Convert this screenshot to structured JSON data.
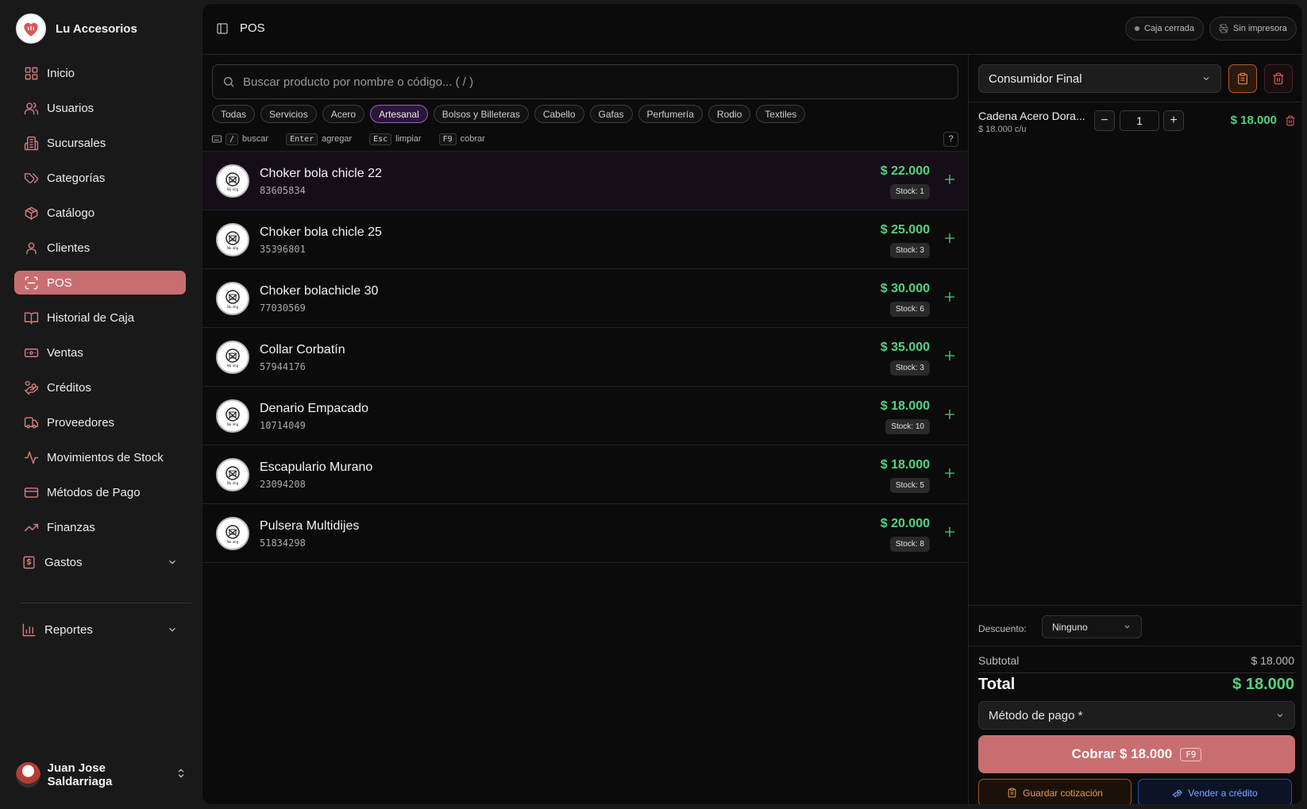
{
  "brand": {
    "name": "Lu Accesorios"
  },
  "nav": {
    "items": [
      {
        "label": "Inicio",
        "icon": "grid-icon"
      },
      {
        "label": "Usuarios",
        "icon": "users-icon"
      },
      {
        "label": "Sucursales",
        "icon": "building-icon"
      },
      {
        "label": "Categorías",
        "icon": "tags-icon"
      },
      {
        "label": "Catálogo",
        "icon": "package-icon"
      },
      {
        "label": "Clientes",
        "icon": "user-icon"
      },
      {
        "label": "POS",
        "icon": "scan-icon",
        "active": true
      },
      {
        "label": "Historial de Caja",
        "icon": "book-icon"
      },
      {
        "label": "Ventas",
        "icon": "banknote-icon"
      },
      {
        "label": "Créditos",
        "icon": "hand-coins-icon"
      },
      {
        "label": "Proveedores",
        "icon": "truck-icon"
      },
      {
        "label": "Movimientos de Stock",
        "icon": "activity-icon"
      },
      {
        "label": "Métodos de Pago",
        "icon": "credit-card-icon"
      },
      {
        "label": "Finanzas",
        "icon": "trending-up-icon"
      },
      {
        "label": "Gastos",
        "icon": "receipt-icon"
      }
    ],
    "reports": "Reportes"
  },
  "user": {
    "name": "Juan Jose Saldarriaga"
  },
  "topbar": {
    "title": "POS",
    "cash_status": "Caja cerrada",
    "printer_status": "Sin impresora"
  },
  "search": {
    "placeholder": "Buscar producto por nombre o código... ( / )"
  },
  "categories": [
    "Todas",
    "Servicios",
    "Acero",
    "Artesanal",
    "Bolsos y Billeteras",
    "Cabello",
    "Gafas",
    "Perfumería",
    "Rodio",
    "Textiles"
  ],
  "active_category": "Artesanal",
  "shortcuts": {
    "k1": "/",
    "t1": "buscar",
    "k2": "Enter",
    "t2": "agregar",
    "k3": "Esc",
    "t3": "limpiar",
    "k4": "F9",
    "t4": "cobrar",
    "help": "?"
  },
  "products": [
    {
      "name": "Choker bola chicle 22",
      "code": "83605834",
      "price": "$ 22.000",
      "stock": "Stock: 1"
    },
    {
      "name": "Choker bola chicle 25",
      "code": "35396801",
      "price": "$ 25.000",
      "stock": "Stock: 3"
    },
    {
      "name": "Choker bolachicle 30",
      "code": "77030569",
      "price": "$ 30.000",
      "stock": "Stock: 6"
    },
    {
      "name": "Collar Corbatín",
      "code": "57944176",
      "price": "$ 35.000",
      "stock": "Stock: 3"
    },
    {
      "name": "Denario Empacado",
      "code": "10714049",
      "price": "$ 18.000",
      "stock": "Stock: 10"
    },
    {
      "name": "Escapulario Murano",
      "code": "23094208",
      "price": "$ 18.000",
      "stock": "Stock: 5"
    },
    {
      "name": "Pulsera Multidijes",
      "code": "51834298",
      "price": "$ 20.000",
      "stock": "Stock: 8"
    }
  ],
  "cart": {
    "customer": "Consumidor Final",
    "item": {
      "name": "Cadena Acero Dora...",
      "unit": "$ 18.000 c/u",
      "qty": "1",
      "price": "$ 18.000"
    },
    "discount_label": "Descuento:",
    "discount_value": "Ninguno",
    "subtotal_label": "Subtotal",
    "subtotal": "$ 18.000",
    "total_label": "Total",
    "total": "$ 18.000",
    "payment_placeholder": "Método de pago *",
    "charge_label": "Cobrar $ 18.000",
    "charge_key": "F9",
    "save_quote": "Guardar cotización",
    "sell_credit": "Vender a crédito"
  },
  "colors": {
    "accent": "#c96e70",
    "price": "#55d37e",
    "active_chip": "#9b5ccc"
  }
}
